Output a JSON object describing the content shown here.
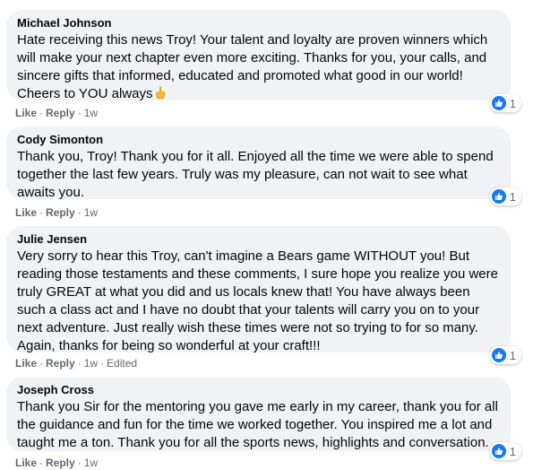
{
  "comments": [
    {
      "author": "Michael Johnson",
      "text": "Hate receiving this news Troy! Your talent and loyalty are proven winners which will make your next chapter even more exciting. Thanks for you, your calls, and sincere gifts that informed, educated and promoted what good in our world! Cheers to YOU always",
      "emoji": "hand-pointing-icon",
      "like": "Like",
      "reply": "Reply",
      "time": "1w",
      "edited": "",
      "reactions": "1"
    },
    {
      "author": "Cody Simonton",
      "text": "Thank you, Troy! Thank you for it all. Enjoyed all the time we were able to spend together the last few years. Truly was my pleasure, can not wait to see what awaits you.",
      "like": "Like",
      "reply": "Reply",
      "time": "1w",
      "edited": "",
      "reactions": "1"
    },
    {
      "author": "Julie Jensen",
      "text": "Very sorry to hear this Troy, can't imagine a Bears game WITHOUT you! But reading those testaments and these comments, I sure hope you realize you were truly GREAT at what you did and us locals knew that! You have always been such a class act and I have no doubt that your talents will carry you on to your next adventure. Just really wish these times were not so trying to for so many. Again, thanks for being so wonderful at your craft!!!",
      "like": "Like",
      "reply": "Reply",
      "time": "1w",
      "edited": "Edited",
      "reactions": "1"
    },
    {
      "author": "Joseph Cross",
      "text": "Thank you Sir for the mentoring you gave me early in my career, thank you for all the guidance and fun for the time we worked together. You inspired me a lot and taught me a ton. Thank you for all the sports news, highlights and conversation.",
      "like": "Like",
      "reply": "Reply",
      "time": "1w",
      "edited": "",
      "reactions": "1"
    }
  ],
  "colors": {
    "bubble": "#f0f2f5",
    "meta": "#65676b",
    "like_blue": "#1877f2"
  }
}
